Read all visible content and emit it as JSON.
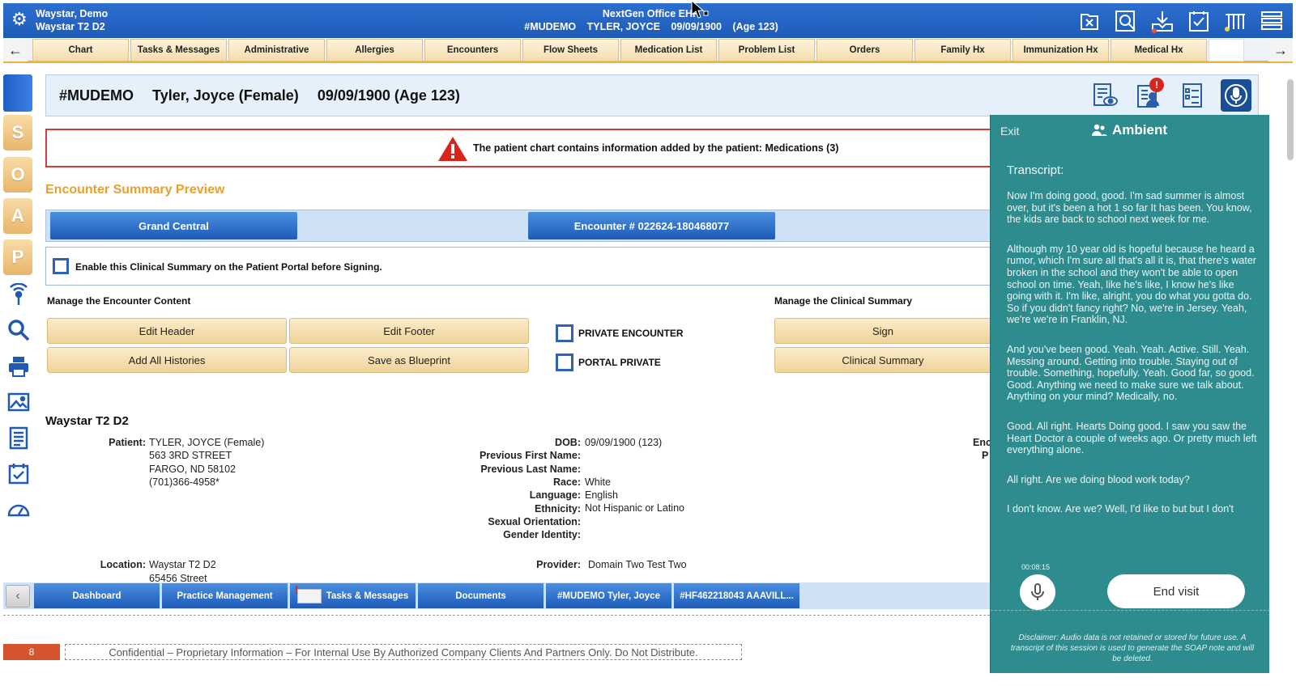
{
  "header": {
    "user_line1": "Waystar, Demo",
    "user_line2": "Waystar T2 D2",
    "app_title": "NextGen Office EHR",
    "patient_id": "#MUDEMO",
    "patient_name": "TYLER, JOYCE",
    "patient_dob": "09/09/1900",
    "patient_age": "(Age 123)",
    "icons": [
      "close-chart-icon",
      "search-document-icon",
      "download-icon",
      "tasks-check-icon",
      "lab-tubes-icon",
      "menu-list-icon"
    ]
  },
  "nav": {
    "tabs": [
      "Chart",
      "Tasks & Messages",
      "Administrative",
      "Allergies",
      "Encounters",
      "Flow Sheets",
      "Medication List",
      "Problem List",
      "Orders",
      "Family Hx",
      "Immunization Hx",
      "Medical Hx"
    ]
  },
  "rail": {
    "soap": [
      "S",
      "O",
      "A",
      "P"
    ]
  },
  "banner": {
    "id": "#MUDEMO",
    "name": "Tyler, Joyce (Female)",
    "dob_age": "09/09/1900 (Age 123)",
    "notification_count": "!"
  },
  "alert": {
    "message": "The patient chart contains information added by the patient: Medications (3)"
  },
  "summary": {
    "title": "Encounter Summary Preview",
    "grand_central": "Grand Central",
    "encounter_number": "Encounter # 022624-180468077",
    "enable_portal_label": "Enable this Clinical Summary on the Patient Portal before Signing."
  },
  "manage": {
    "encounter_label": "Manage the Encounter Content",
    "edit_header": "Edit Header",
    "edit_footer": "Edit Footer",
    "add_histories": "Add All Histories",
    "save_blueprint": "Save as Blueprint",
    "private_encounter": "PRIVATE ENCOUNTER",
    "portal_private": "PORTAL PRIVATE",
    "clinical_label": "Manage the Clinical Summary",
    "sign": "Sign",
    "clinical_summary": "Clinical Summary"
  },
  "details": {
    "site_name": "Waystar T2 D2",
    "patient_label": "Patient:",
    "patient_name": "TYLER, JOYCE (Female)",
    "address1": "563 3RD STREET",
    "address2": "FARGO, ND 58102",
    "phone": "(701)366-4958*",
    "dob_label": "DOB:",
    "dob_value": "09/09/1900 (123)",
    "prev_first_label": "Previous First Name:",
    "prev_last_label": "Previous Last Name:",
    "race_label": "Race:",
    "race_value": "White",
    "language_label": "Language:",
    "language_value": "English",
    "ethnicity_label": "Ethnicity:",
    "ethnicity_value": "Not Hispanic or Latino",
    "sexual_label": "Sexual Orientation:",
    "gender_label": "Gender Identity:",
    "location_label": "Location:",
    "location_value": "Waystar T2 D2",
    "location_street": "65456 Street",
    "provider_label": "Provider:",
    "provider_value": "Domain Two Test Two",
    "clipped_label_1": "Enc",
    "clipped_label_2": "P"
  },
  "bottom_tabs": [
    "Dashboard",
    "Practice Management",
    "Tasks & Messages",
    "Documents",
    "#MUDEMO  Tyler, Joyce",
    "#HF462218043  AAAVILL..."
  ],
  "footer": {
    "page_number": "8",
    "confidential": "Confidential – Proprietary Information – For Internal Use By Authorized Company Clients And Partners Only. Do Not Distribute."
  },
  "ambient": {
    "exit": "Exit",
    "title": "Ambient",
    "transcript_label": "Transcript:",
    "paragraphs": [
      "Now I'm doing good, good. I'm sad summer is almost over, but it's been a hot 1 so far It has been. You know, the kids are back to school next week for me.",
      "Although my 10 year old is hopeful because he heard a rumor, which I'm sure all that's all it is, that there's water broken in the school and they won't be able to open school on time. Yeah, like he's like, I know he's like going with it. I'm like, alright, you do what you gotta do. So if you didn't fancy right? No, we're in Jersey. Yeah, we're we're in Franklin, NJ.",
      "And you've been good. Yeah. Yeah. Active. Still. Yeah. Messing around. Getting into trouble. Staying out of trouble. Something, hopefully. Yeah. Good far, so good. Good. Anything we need to make sure we talk about. Anything on your mind? Medically, no.",
      "Good. All right. Hearts Doing good. I saw you saw the Heart Doctor a couple of weeks ago. Or pretty much left everything alone.",
      "All right. Are we doing blood work today?",
      "I don't know. Are we? Well, I'd like to but but I don't"
    ],
    "timer": "00:08:15",
    "end_visit": "End visit",
    "disclaimer": "Disclaimer: Audio data is not retained or stored for future use. A transcript of this session is used to generate the SOAP note and will be deleted."
  }
}
